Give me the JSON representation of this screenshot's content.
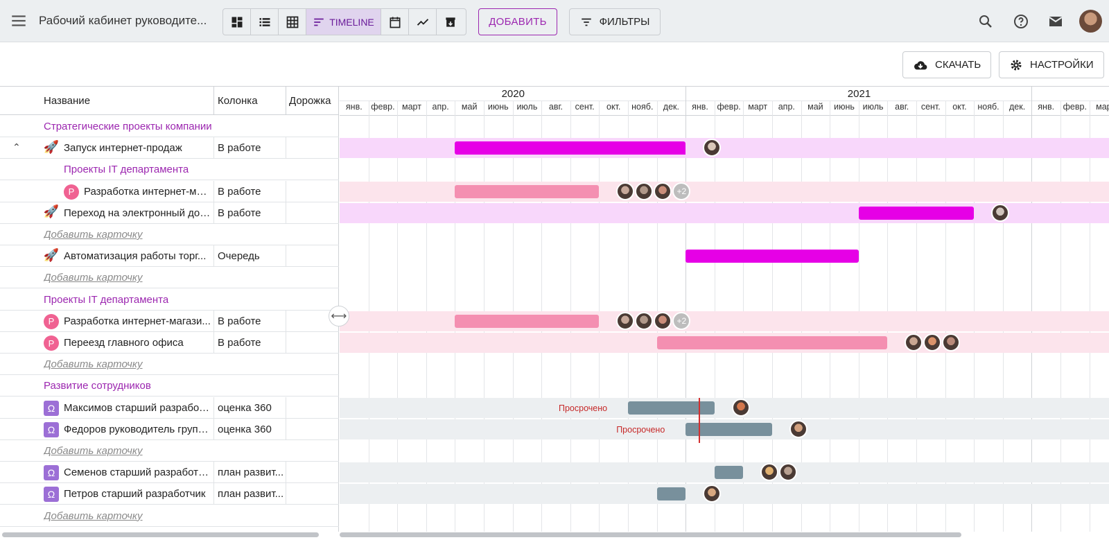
{
  "header": {
    "title": "Рабочий кабинет руководите...",
    "views": [
      "dashboard-icon",
      "list-icon",
      "grid-icon",
      "timeline-icon",
      "calendar-icon",
      "chart-icon",
      "archive-icon"
    ],
    "active_view_label": "TIMELINE",
    "add_label": "ДОБАВИТЬ",
    "filters_label": "ФИЛЬТРЫ"
  },
  "toolbar": {
    "download_label": "СКАЧАТЬ",
    "settings_label": "НАСТРОЙКИ"
  },
  "columns": {
    "name": "Название",
    "column": "Колонка",
    "lane": "Дорожка"
  },
  "timeline": {
    "years": [
      "2020",
      "2021"
    ],
    "months": [
      "янв.",
      "февр.",
      "март",
      "апр.",
      "май",
      "июнь",
      "июль",
      "авг.",
      "сент.",
      "окт.",
      "нояб.",
      "дек.",
      "янв.",
      "февр.",
      "март",
      "апр.",
      "май",
      "июнь",
      "июль",
      "авг.",
      "сент.",
      "окт.",
      "нояб.",
      "дек.",
      "янв.",
      "февр.",
      "мар"
    ],
    "overdue_label": "Просрочено"
  },
  "rows": [
    {
      "type": "group",
      "name": "Стратегические проекты компании"
    },
    {
      "type": "card",
      "icon": "rocket-icon",
      "name": "Запуск интернет-продаж",
      "column": "В работе",
      "expanded": true
    },
    {
      "type": "subgroup",
      "name": "Проекты IT департамента"
    },
    {
      "type": "card",
      "icon": "p-badge",
      "name": "Разработка интернет-ма...",
      "column": "В работе",
      "more": "+2"
    },
    {
      "type": "card",
      "icon": "rocket-icon",
      "name": "Переход на электронный док...",
      "column": "В работе"
    },
    {
      "type": "add",
      "name": "Добавить карточку"
    },
    {
      "type": "card",
      "icon": "rocket-icon",
      "name": "Автоматизация работы торг...",
      "column": "Очередь"
    },
    {
      "type": "add",
      "name": "Добавить карточку"
    },
    {
      "type": "group",
      "name": "Проекты IT департамента"
    },
    {
      "type": "card",
      "icon": "p-badge",
      "name": "Разработка интернет-магази...",
      "column": "В работе",
      "more": "+2"
    },
    {
      "type": "card",
      "icon": "p-badge",
      "name": "Переезд главного офиса",
      "column": "В работе"
    },
    {
      "type": "add",
      "name": "Добавить карточку"
    },
    {
      "type": "group",
      "name": "Развитие сотрудников"
    },
    {
      "type": "card",
      "icon": "omega-icon",
      "name": "Максимов старший разработ...",
      "column": "оценка 360"
    },
    {
      "type": "card",
      "icon": "omega-icon",
      "name": "Федоров руководитель групп...",
      "column": "оценка 360"
    },
    {
      "type": "add",
      "name": "Добавить карточку"
    },
    {
      "type": "card",
      "icon": "omega-icon",
      "name": "Семенов старший разработч...",
      "column": "план развит..."
    },
    {
      "type": "card",
      "icon": "omega-icon",
      "name": "Петров старший разработчик",
      "column": "план развит..."
    },
    {
      "type": "add",
      "name": "Добавить карточку"
    }
  ],
  "colors": {
    "accent": "#9c27b0",
    "magenta_bar": "#e600e6",
    "pink_bar": "#f48fb1",
    "grey_bar": "#78909c",
    "overdue": "#c62828"
  }
}
